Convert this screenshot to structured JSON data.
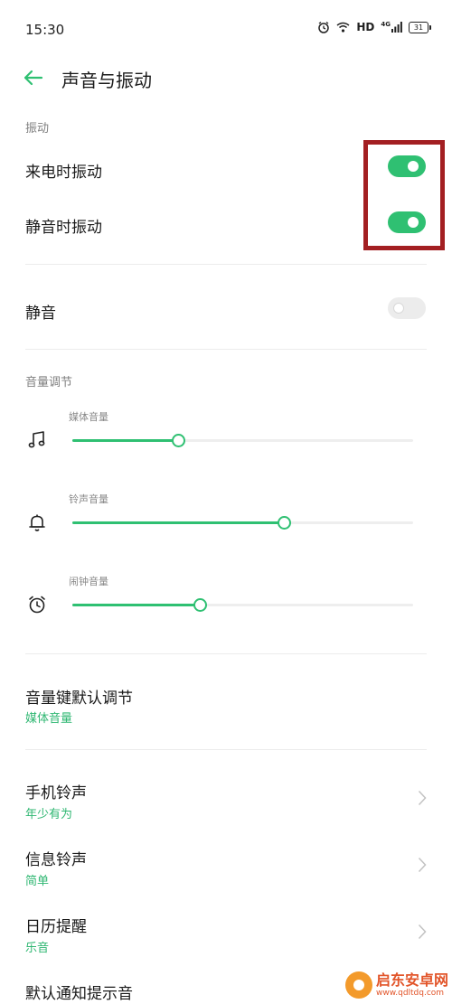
{
  "status_bar": {
    "time": "15:30",
    "icons": [
      "alarm-icon",
      "wifi-icon",
      "hd-icon",
      "signal-icon",
      "battery-icon"
    ],
    "hd": "HD",
    "network": "4G",
    "battery": "31"
  },
  "header": {
    "title": "声音与振动",
    "back_icon": "back-arrow-icon"
  },
  "vibration": {
    "section_label": "振动",
    "incoming_call": {
      "label": "来电时振动",
      "on": true
    },
    "silent": {
      "label": "静音时振动",
      "on": true
    }
  },
  "mute": {
    "label": "静音",
    "on": false
  },
  "volume": {
    "section_label": "音量调节",
    "media": {
      "caption": "媒体音量",
      "icon": "music-note-icon",
      "level": 0.31
    },
    "ringtone": {
      "caption": "铃声音量",
      "icon": "bell-icon",
      "level": 0.62
    },
    "alarm": {
      "caption": "闹钟音量",
      "icon": "alarm-clock-icon",
      "level": 0.375
    }
  },
  "volume_key": {
    "label": "音量键默认调节",
    "value": "媒体音量"
  },
  "ringtones": [
    {
      "label": "手机铃声",
      "value": "年少有为"
    },
    {
      "label": "信息铃声",
      "value": "简单"
    },
    {
      "label": "日历提醒",
      "value": "乐音"
    },
    {
      "label": "默认通知提示音"
    }
  ],
  "watermark": {
    "name": "启东安卓网",
    "url": "www.qdltdq.com"
  },
  "colors": {
    "accent": "#2fc072",
    "highlight": "#a31f22",
    "text": "#1a1a1a",
    "secondary": "#808080"
  }
}
